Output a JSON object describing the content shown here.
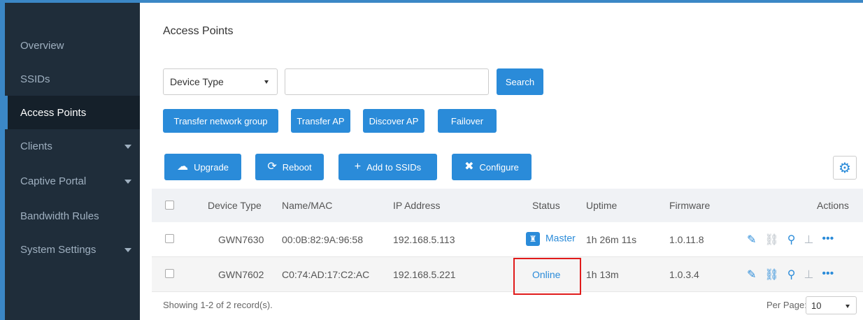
{
  "sidebar": {
    "items": [
      {
        "label": "Overview"
      },
      {
        "label": "SSIDs"
      },
      {
        "label": "Access Points"
      },
      {
        "label": "Clients"
      },
      {
        "label": "Captive Portal"
      },
      {
        "label": "Bandwidth Rules"
      },
      {
        "label": "System Settings"
      }
    ]
  },
  "page": {
    "title": "Access Points"
  },
  "filter": {
    "device_type": "Device Type",
    "search_value": "",
    "search_label": "Search"
  },
  "toolbar1": {
    "transfer_group": "Transfer network group",
    "transfer_ap": "Transfer AP",
    "discover_ap": "Discover AP",
    "failover": "Failover"
  },
  "toolbar2": {
    "upgrade": "Upgrade",
    "reboot": "Reboot",
    "add_ssids": "Add to SSIDs",
    "configure": "Configure"
  },
  "table": {
    "headers": [
      "Device Type",
      "Name/MAC",
      "IP Address",
      "Status",
      "Uptime",
      "Firmware",
      "Actions"
    ],
    "rows": [
      {
        "device_type": "GWN7630",
        "mac": "00:0B:82:9A:96:58",
        "ip": "192.168.5.113",
        "status": "Master",
        "uptime": "1h 26m 11s",
        "firmware": "1.0.11.8"
      },
      {
        "device_type": "GWN7602",
        "mac": "C0:74:AD:17:C2:AC",
        "ip": "192.168.5.221",
        "status": "Online",
        "uptime": "1h 13m",
        "firmware": "1.0.3.4"
      }
    ]
  },
  "footer": {
    "records": "Showing 1-2 of 2 record(s).",
    "per_page_label": "Per Page:",
    "per_page_value": "10"
  },
  "colors": {
    "accent": "#2a8bd9",
    "sidebar": "#1f2d3a",
    "highlight": "#e01b1b"
  }
}
